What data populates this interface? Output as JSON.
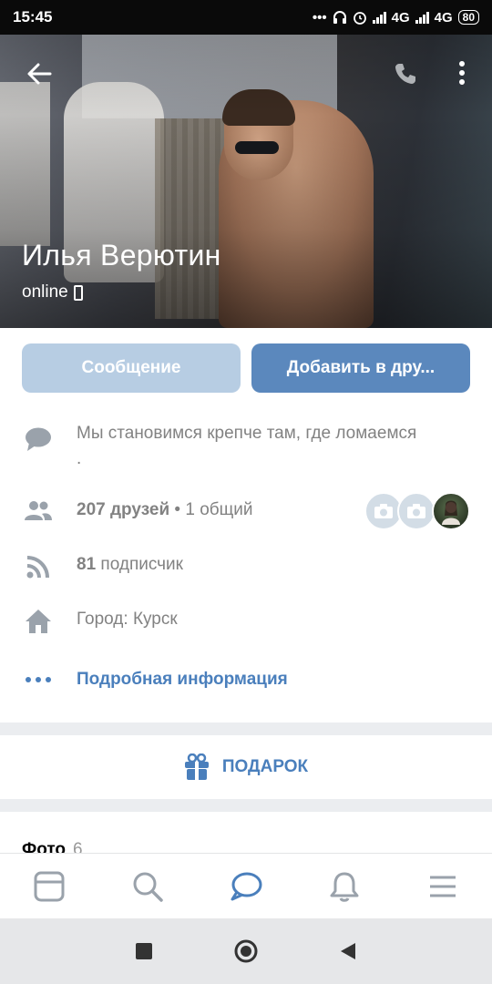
{
  "status_bar": {
    "time": "15:45",
    "network1": "4G",
    "network2": "4G",
    "battery": "80"
  },
  "profile": {
    "name": "Илья Верютин",
    "status": "online"
  },
  "actions": {
    "message_label": "Сообщение",
    "add_friend_label": "Добавить в дру..."
  },
  "info": {
    "status_text": "Мы становимся крепче там, где ломаемся .",
    "friends_count": "207 друзей",
    "friends_mutual": " • 1 общий",
    "subscribers_count": "81",
    "subscribers_label": " подписчик",
    "city": "Город: Курск",
    "more_info": "Подробная информация"
  },
  "gift": {
    "label": "ПОДАРОК"
  },
  "photos": {
    "title": "Фото",
    "count": "6"
  },
  "bottom_nav": {
    "items": [
      "feed-icon",
      "search-icon",
      "messages-icon",
      "notifications-icon",
      "menu-icon"
    ],
    "active": "messages-icon"
  },
  "colors": {
    "accent": "#4a7fbc",
    "button_primary": "#5b88bd",
    "button_secondary": "#b7cde3",
    "text_secondary": "#828282",
    "separator": "#ebedf0"
  }
}
